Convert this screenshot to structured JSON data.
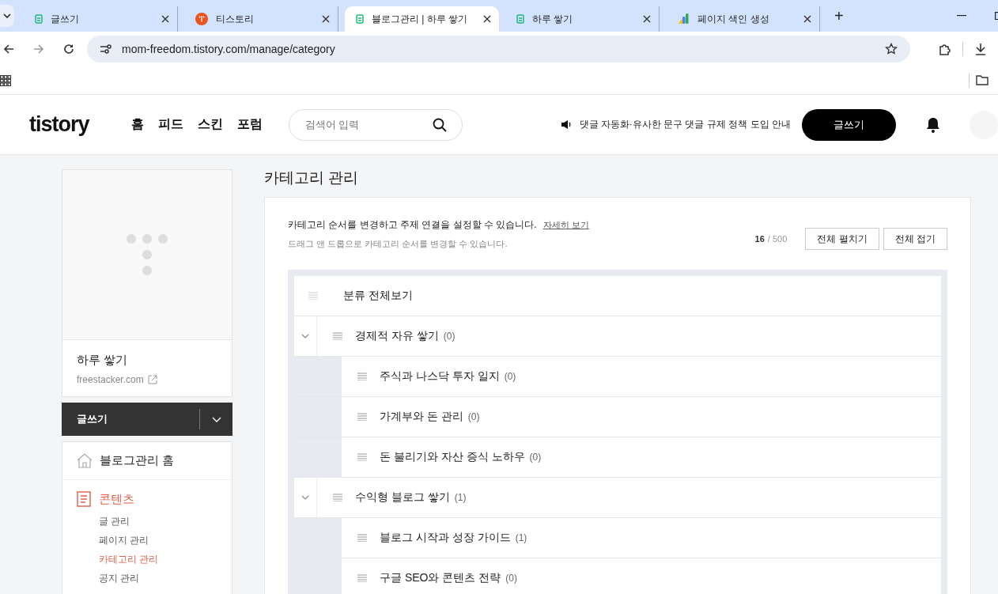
{
  "browser": {
    "tabs": [
      {
        "title": "글쓰기",
        "kind": "blog",
        "selected": false
      },
      {
        "title": "티스토리",
        "kind": "tistory",
        "selected": false
      },
      {
        "title": "블로그관리 | 하루 쌓기",
        "kind": "blog",
        "selected": true
      },
      {
        "title": "하루 쌓기",
        "kind": "blog",
        "selected": false
      },
      {
        "title": "페이지 색인 생성",
        "kind": "chart",
        "selected": false
      }
    ],
    "new_tab": "+",
    "url": "mom-freedom.tistory.com/manage/category"
  },
  "header": {
    "logo": "tistory",
    "nav": [
      "홈",
      "피드",
      "스킨",
      "포럼"
    ],
    "search": {
      "placeholder": "검색어 입력"
    },
    "notice": "댓글 자동화·유사한 문구 댓글 규제 정책 도입 안내",
    "write_button": "글쓰기"
  },
  "sidebar": {
    "blog_name": "하루 쌓기",
    "domain": "freestacker.com",
    "write_button": "글쓰기",
    "home": "블로그관리 홈",
    "section": {
      "title": "콘텐츠",
      "selected": true,
      "items": [
        {
          "label": "글 관리",
          "selected": false
        },
        {
          "label": "페이지 관리",
          "selected": false
        },
        {
          "label": "카테고리 관리",
          "selected": true
        },
        {
          "label": "공지 관리",
          "selected": false
        }
      ]
    }
  },
  "main": {
    "title": "카테고리 관리",
    "description": "카테고리 순서를 변경하고 주제 연결을 설정할 수 있습니다.",
    "help_link": "자세히 보기",
    "hint": "드래그 앤 드롭으로 카테고리 순서를 변경할 수 있습니다.",
    "count": "16",
    "limit": "/ 500",
    "buttons": [
      "전체 펼치기",
      "전체 접기"
    ],
    "tree": {
      "root": "분류 전체보기",
      "categories": [
        {
          "name": "경제적 자유 쌓기",
          "count": "(0)",
          "expanded": true,
          "children": [
            {
              "name": "주식과 나스닥 투자 일지",
              "count": "(0)"
            },
            {
              "name": "가계부와 돈 관리",
              "count": "(0)"
            },
            {
              "name": "돈 불리기와 자산 증식 노하우",
              "count": "(0)"
            }
          ]
        },
        {
          "name": "수익형 블로그 쌓기",
          "count": "(1)",
          "expanded": true,
          "children": [
            {
              "name": "블로그 시작과 성장 가이드",
              "count": "(1)"
            },
            {
              "name": "구글 SEO와 콘텐츠 전략",
              "count": "(0)"
            }
          ]
        }
      ]
    }
  }
}
